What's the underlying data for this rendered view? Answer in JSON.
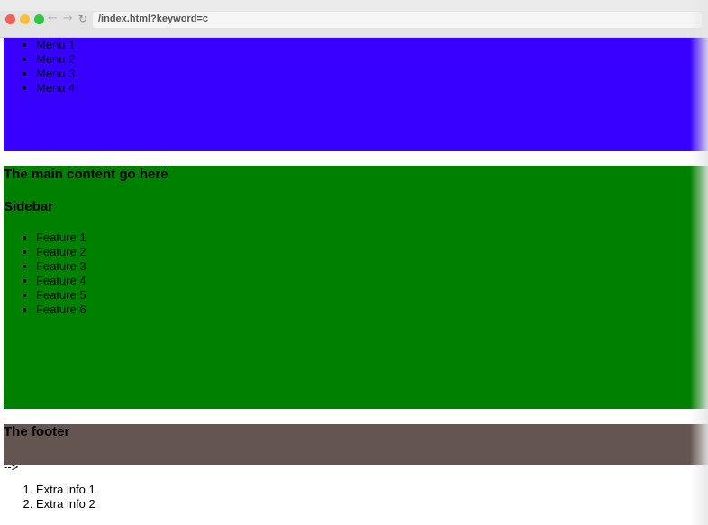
{
  "browser": {
    "url": "/index.html?keyword=c",
    "back_icon": "arrow-left",
    "forward_icon": "arrow-right",
    "reload_icon": "reload",
    "colors": {
      "close": "#f25f58",
      "minimize": "#f8bf3a",
      "zoom": "#2fc642"
    }
  },
  "header": {
    "menu": [
      "Menu 1",
      "Menu 2",
      "Menu 3",
      "Menu 4"
    ],
    "background": "#3700ff"
  },
  "main": {
    "content_title": "The main content go here",
    "sidebar_title": "Sidebar",
    "features": [
      "Feature 1",
      "Feature 2",
      "Feature 3",
      "Feature 4",
      "Feature 5",
      "Feature 6"
    ],
    "background": "#008000"
  },
  "footer": {
    "title": "The footer",
    "background": "#645550"
  },
  "stray_text": "-->",
  "extra_info": [
    "Extra info 1",
    "Extra info 2"
  ]
}
